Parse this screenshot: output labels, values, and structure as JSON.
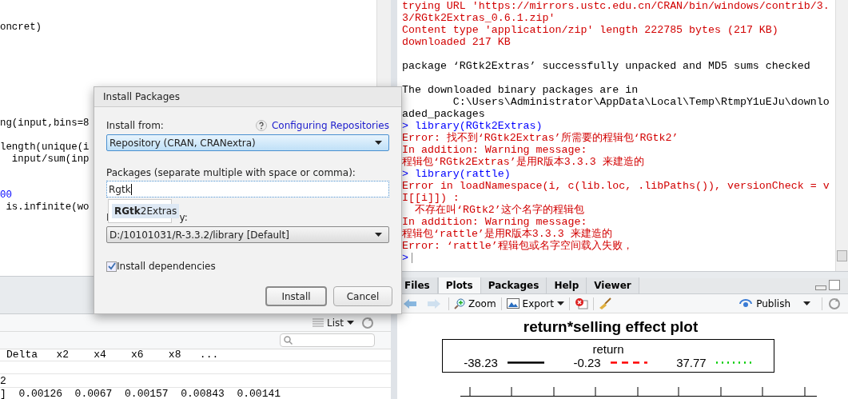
{
  "editor": {
    "lines": [
      {
        "kind": "code",
        "text": "oncret)"
      },
      {
        "kind": "blank"
      },
      {
        "kind": "blank"
      },
      {
        "kind": "blank"
      },
      {
        "kind": "blank"
      },
      {
        "kind": "blank"
      },
      {
        "kind": "blank"
      },
      {
        "kind": "blank"
      },
      {
        "kind": "code",
        "text": "ng(input,bins=8"
      },
      {
        "kind": "blank"
      },
      {
        "kind": "code",
        "text": "length(unique(i"
      },
      {
        "kind": "code",
        "text": "  input/sum(inp"
      },
      {
        "kind": "blank"
      },
      {
        "kind": "blank"
      },
      {
        "kind": "number",
        "text": "00"
      },
      {
        "kind": "code",
        "text": " is.infinite(wo"
      }
    ]
  },
  "environment": {
    "view_menu": "List",
    "columns_row": "Delta   x2    x4    x6    x8   ...",
    "rows": [
      "2",
      "]  0.00126  0.0067  0.00157  0.00843  0.00141"
    ]
  },
  "dialog": {
    "title": "Install Packages",
    "install_from_label": "Install from:",
    "help_link": "Configuring Repositories",
    "install_from_value": "Repository (CRAN, CRANextra)",
    "packages_label": "Packages (separate multiple with space or comma):",
    "packages_value": "Rgtk",
    "suggestion": "**RGtk**2Extras",
    "library_label_fragments": [
      "I",
      "y:"
    ],
    "library_value": "D:/10101031/R-3.3.2/library [Default]",
    "install_dependencies": {
      "label": "Install dependencies",
      "checked": true
    },
    "buttons": [
      "Install",
      "Cancel"
    ]
  },
  "console": {
    "lines": [
      {
        "kind": "error",
        "text": "trying URL 'https://mirrors.ustc.edu.cn/CRAN/bin/windows/contrib/3."
      },
      {
        "kind": "error",
        "text": "3/RGtk2Extras_0.6.1.zip'"
      },
      {
        "kind": "error",
        "text": "Content type 'application/zip' length 222785 bytes (217 KB)"
      },
      {
        "kind": "error",
        "text": "downloaded 217 KB"
      },
      {
        "kind": "blank"
      },
      {
        "kind": "output",
        "text": "package ‘RGtk2Extras’ successfully unpacked and MD5 sums checked"
      },
      {
        "kind": "blank"
      },
      {
        "kind": "output",
        "text": "The downloaded binary packages are in"
      },
      {
        "kind": "output",
        "text": "        C:\\Users\\Administrator\\AppData\\Local\\Temp\\RtmpY1uEJu\\downlo"
      },
      {
        "kind": "output",
        "text": "aded_packages"
      },
      {
        "kind": "input",
        "text": "> library(RGtk2Extras)"
      },
      {
        "kind": "error",
        "text": "Error: 找不到‘RGtk2Extras’所需要的程辑包‘RGtk2’"
      },
      {
        "kind": "error",
        "text": "In addition: Warning message:"
      },
      {
        "kind": "error",
        "text": "程辑包‘RGtk2Extras’是用R版本3.3.3 来建造的"
      },
      {
        "kind": "input",
        "text": "> library(rattle)"
      },
      {
        "kind": "error",
        "text": "Error in loadNamespace(i, c(lib.loc, .libPaths()), versionCheck = v"
      },
      {
        "kind": "error",
        "text": "I[[i]]) :"
      },
      {
        "kind": "error",
        "text": "  不存在叫‘RGtk2’这个名字的程辑包"
      },
      {
        "kind": "error",
        "text": "In addition: Warning message:"
      },
      {
        "kind": "error",
        "text": "程辑包‘rattle’是用R版本3.3.3 来建造的"
      },
      {
        "kind": "error",
        "text": "Error: ‘rattle’程辑包或名字空间载入失败，"
      },
      {
        "kind": "prompt",
        "text": ">"
      }
    ]
  },
  "plots_pane": {
    "tabs": [
      {
        "label": "Files",
        "selected": false
      },
      {
        "label": "Plots",
        "selected": true
      },
      {
        "label": "Packages",
        "selected": false
      },
      {
        "label": "Help",
        "selected": false
      },
      {
        "label": "Viewer",
        "selected": false
      }
    ],
    "toolbar": {
      "zoom": "Zoom",
      "export": "Export",
      "publish": "Publish"
    },
    "plot": {
      "title": "return*selling effect plot",
      "legend_title": "return",
      "legend": [
        {
          "label": "-38.23",
          "color": "#000000",
          "kind": "solid"
        },
        {
          "label": "-0.23",
          "color": "#ff0000",
          "kind": "dashed"
        },
        {
          "label": "37.77",
          "color": "#00cc00",
          "kind": "dotted"
        }
      ]
    }
  }
}
